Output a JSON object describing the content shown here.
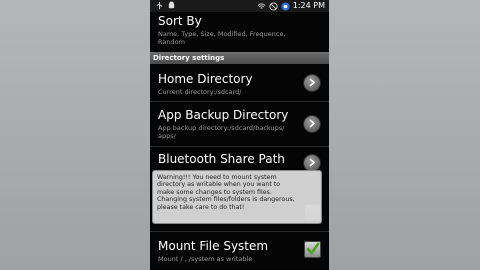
{
  "status_bar": {
    "time": "1:24 PM"
  },
  "sort": {
    "title": "Sort By",
    "subtitle": "Name, Type, Size, Modified, Frequence, Random"
  },
  "section": {
    "label": "Directory settings"
  },
  "home": {
    "title": "Home Directory",
    "subtitle": "Current directory:/sdcard/"
  },
  "backup": {
    "title": "App Backup Directory",
    "subtitle_line1": "App backup directory:/sdcard/backups/",
    "subtitle_line2": "apps/"
  },
  "bluetooth": {
    "title": "Bluetooth Share Path"
  },
  "toast": {
    "line1": "Warning!!! You need to mount system",
    "line2": "directory as writable when you want to",
    "line3": "make some changes to system files.",
    "line4": "Changing system files/folders is dangerous,",
    "line5": "please take care to do that!"
  },
  "mount": {
    "title": "Mount File System",
    "subtitle": "Mount / , /system as writable",
    "checked": true
  },
  "colors": {
    "accent": "#4ca31e",
    "background": "#050505",
    "section": "#5a5a5a"
  }
}
